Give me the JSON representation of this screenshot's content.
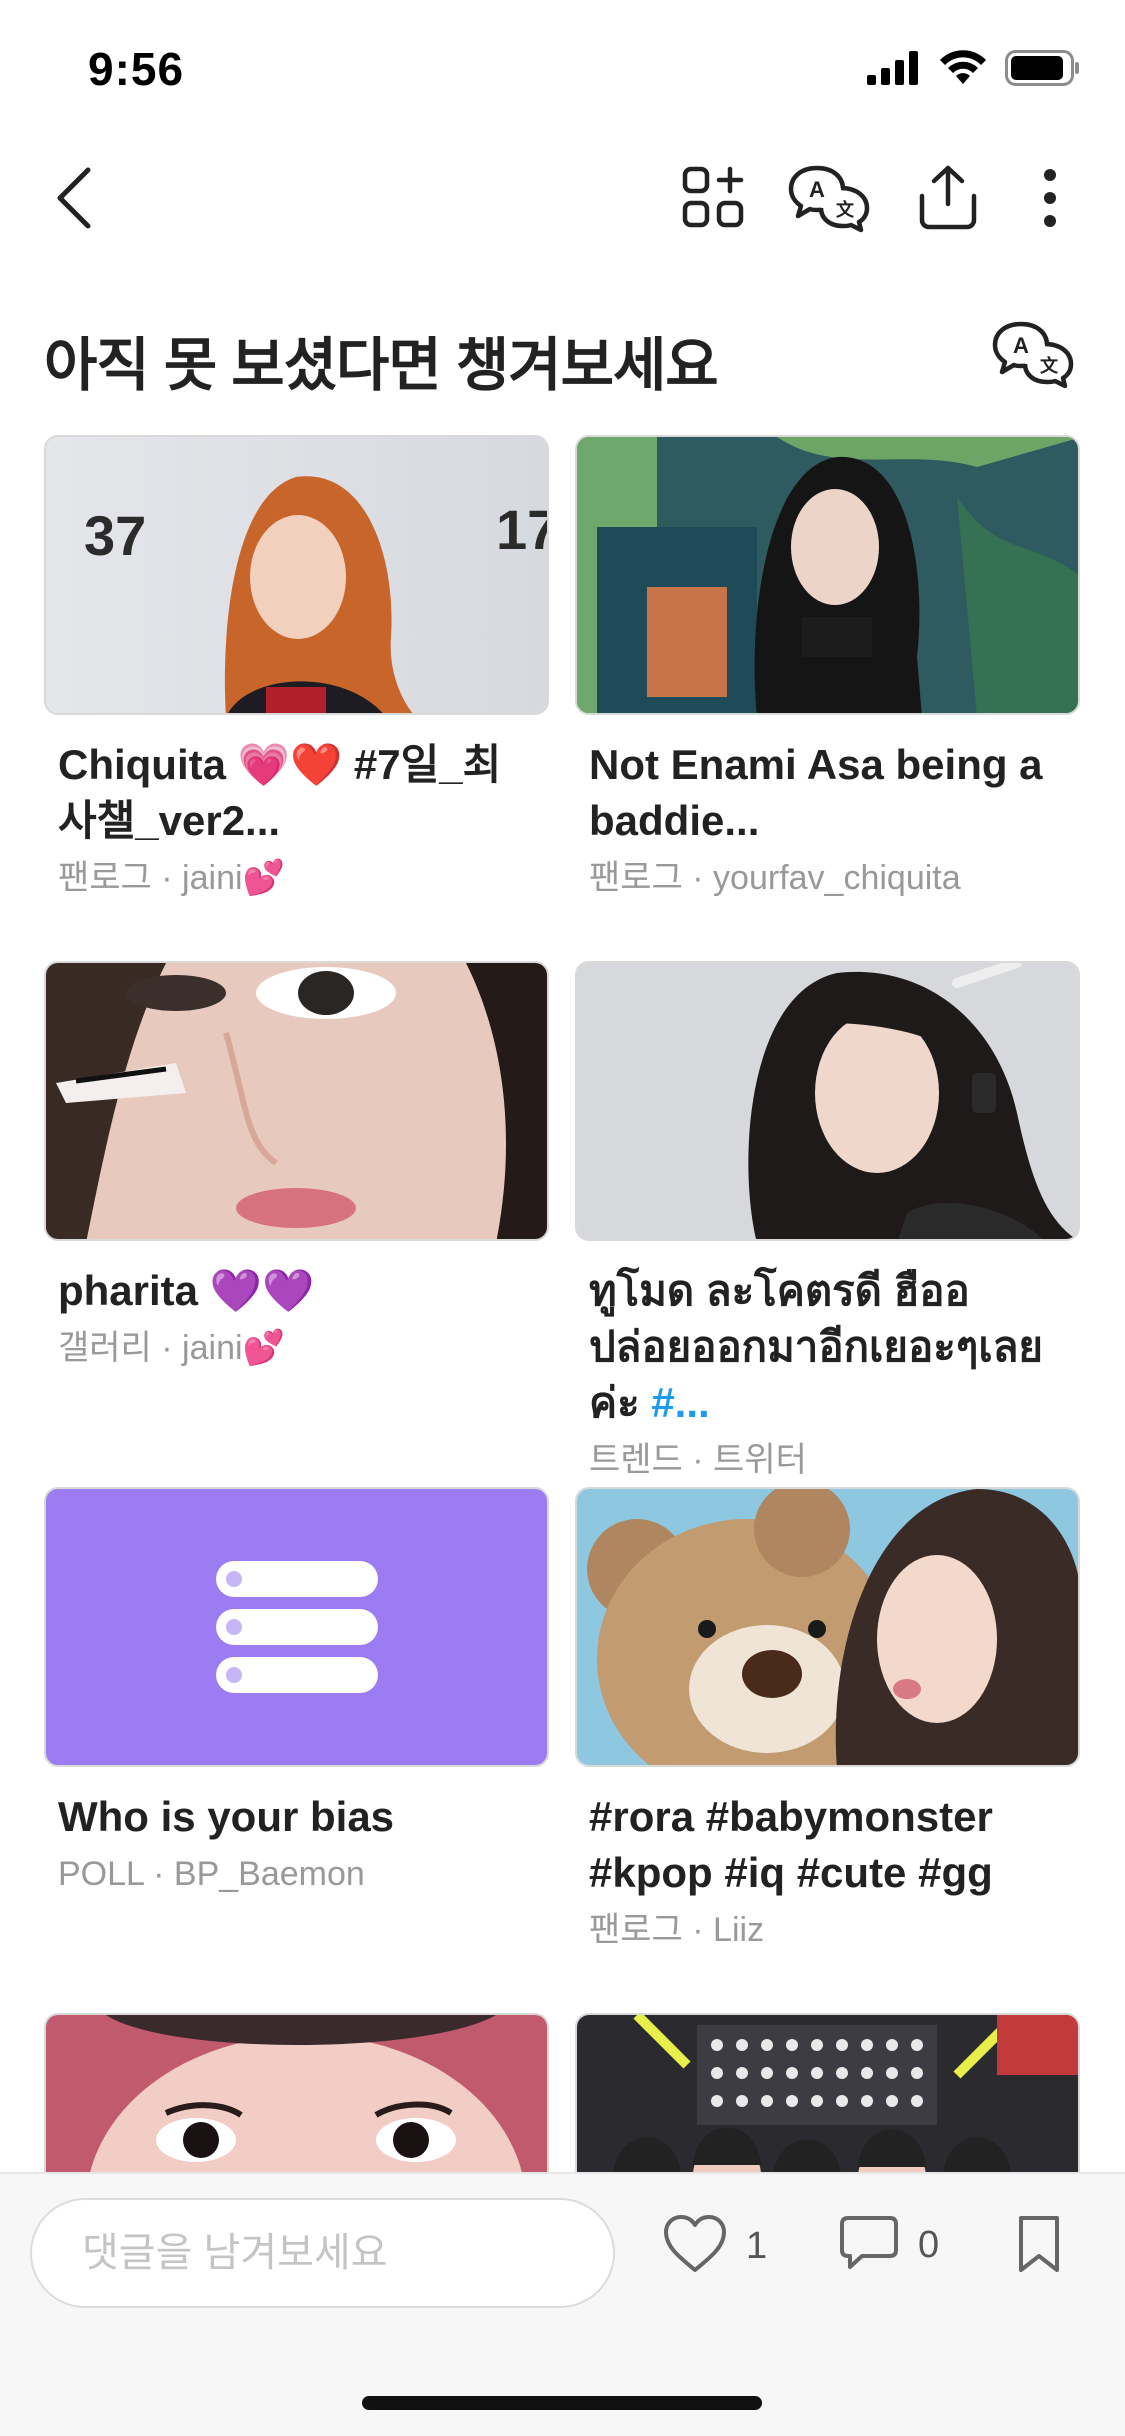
{
  "status_bar": {
    "time": "9:56"
  },
  "section": {
    "title": "아직 못 보셨다면 챙겨보세요"
  },
  "cards": [
    {
      "title": "Chiquita 💗❤️ #7일_최사챌_ver2...",
      "meta": "팬로그 · jaini💕"
    },
    {
      "title": "Not Enami Asa being a baddie...",
      "meta": "팬로그 · yourfav_chiquita"
    },
    {
      "title": "pharita 💜💜",
      "meta": "갤러리 · jaini💕"
    },
    {
      "title": "ทูโมด ละโคตรดี ฮืออ ปล่อยออกมาอีกเยอะๆเลยค่ะ ",
      "title_hashtag": "#...",
      "meta": "트렌드 · 트위터"
    },
    {
      "title": "Who is your bias",
      "meta": "POLL · BP_Baemon"
    },
    {
      "title": "#rora #babymonster #kpop #iq #cute #gg",
      "meta": "팬로그 · Liiz"
    }
  ],
  "comment": {
    "placeholder": "댓글을 남겨보세요"
  },
  "actions": {
    "like_count": "1",
    "comment_count": "0"
  },
  "colors": {
    "poll_purple": "#9b7cf2",
    "heart_pink": "#ff3fa4",
    "heart_purple": "#a44bea"
  },
  "icons": [
    "back-icon",
    "add-widget-icon",
    "translate-icon",
    "share-icon",
    "more-icon",
    "heart-icon",
    "comment-icon",
    "bookmark-icon",
    "poll-list-icon"
  ]
}
